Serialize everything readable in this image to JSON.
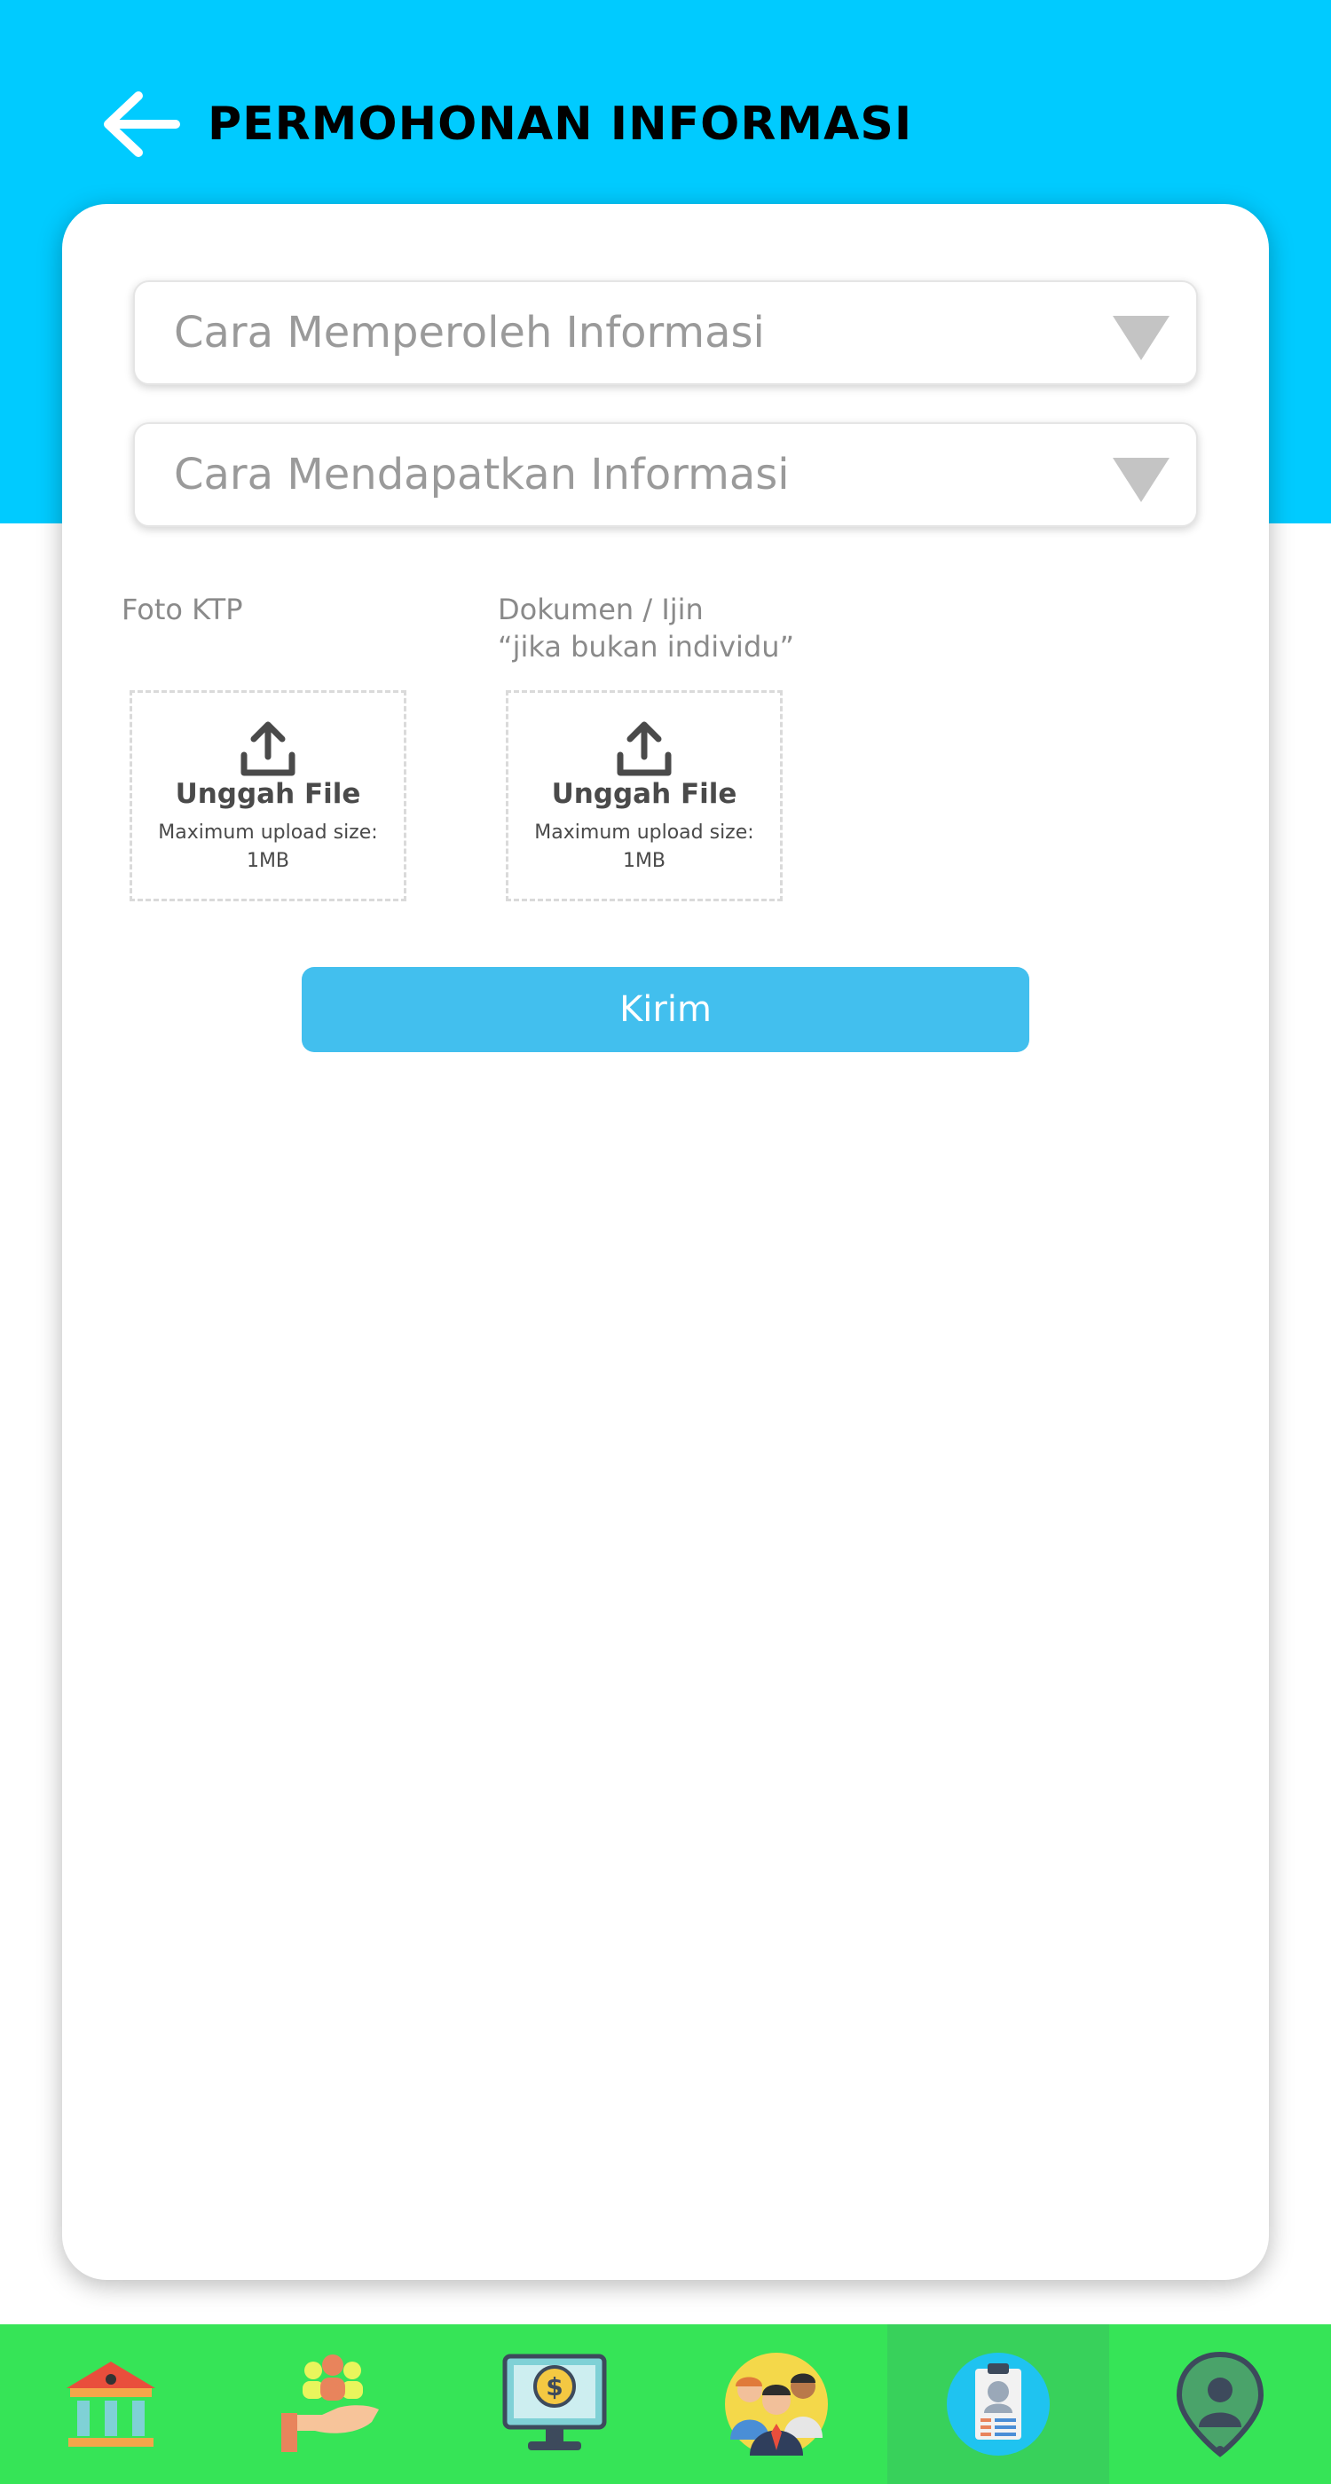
{
  "header": {
    "title": "PERMOHONAN INFORMASI",
    "back_icon": "arrow-left-icon",
    "background_color": "#00cbff"
  },
  "form": {
    "select_method_obtain": {
      "placeholder": "Cara Memperoleh Informasi",
      "icon": "caret-down-icon"
    },
    "select_method_get": {
      "placeholder": "Cara Mendapatkan Informasi",
      "icon": "caret-down-icon"
    },
    "upload_ktp": {
      "label": "Foto KTP",
      "title": "Unggah File",
      "subtitle": "Maximum upload size: 1MB",
      "icon": "upload-icon"
    },
    "upload_document": {
      "label_line1": "Dokumen / Ijin",
      "label_line2": "“jika bukan individu”",
      "title": "Unggah File",
      "subtitle": "Maximum upload size: 1MB",
      "icon": "upload-icon"
    },
    "submit_label": "Kirim",
    "submit_color": "#42bfee"
  },
  "bottom_nav": {
    "background_color": "#36e457",
    "items": [
      {
        "icon": "bank-building-icon",
        "active": false
      },
      {
        "icon": "community-hand-icon",
        "active": false
      },
      {
        "icon": "monitor-dollar-icon",
        "active": false
      },
      {
        "icon": "people-group-icon",
        "active": false
      },
      {
        "icon": "id-clipboard-icon",
        "active": true
      },
      {
        "icon": "location-person-icon",
        "active": false
      }
    ]
  }
}
